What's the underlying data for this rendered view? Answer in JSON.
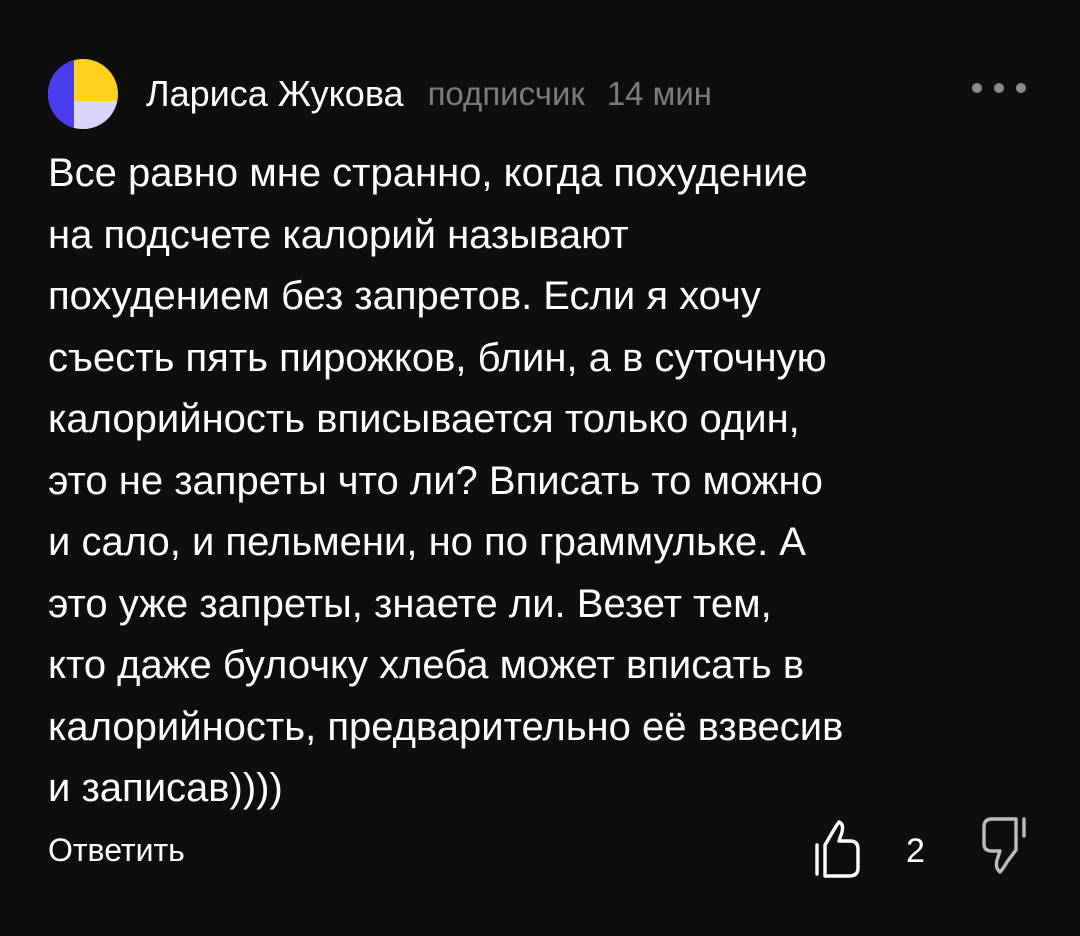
{
  "comment": {
    "author": "Лариса Жукова",
    "role": "подписчик",
    "time": "14 мин",
    "text": "Все равно мне странно, когда похудение\nна подсчете калорий называют\nпохудением без запретов. Если я хочу\nсъесть пять пирожков, блин, а в суточную\nкалорийность вписывается только один,\nэто не запреты что ли? Вписать то можно\nи сало, и пельмени, но по граммульке. А\nэто уже запреты, знаете ли. Везет тем,\nкто даже булочку хлеба может вписать в\nкалорийность, предварительно её взвесив\nи записав))))",
    "reply_label": "Ответить",
    "like_count": "2"
  },
  "icons": {
    "avatar": "avatar-icon",
    "more": "more-icon",
    "like": "thumb-up-icon",
    "dislike": "thumb-down-icon"
  },
  "colors": {
    "background": "#0e0e0e",
    "text": "#ffffff",
    "muted": "#7c7c7c",
    "avatar_blue": "#4a3df0",
    "avatar_yellow": "#ffd21e",
    "avatar_lilac": "#ddd4fb"
  }
}
